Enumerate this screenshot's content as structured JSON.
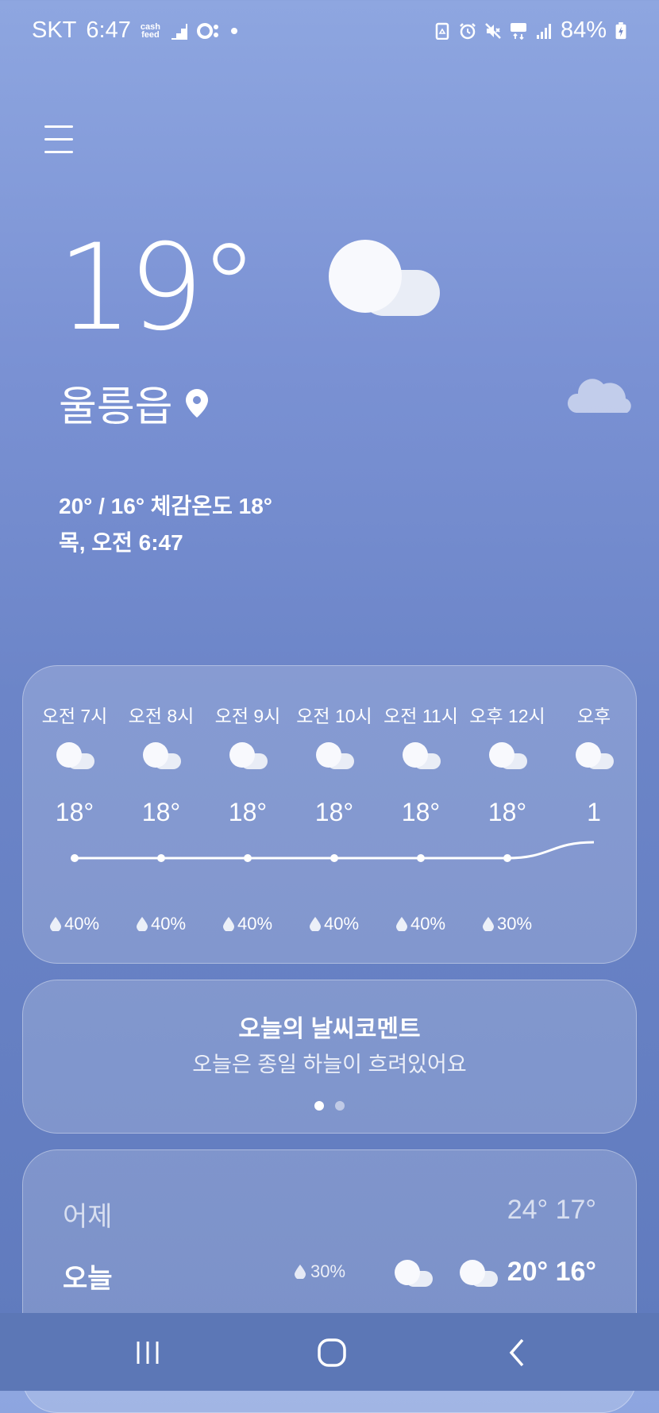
{
  "status_bar": {
    "carrier": "SKT",
    "time": "6:47",
    "cashfeed_top": "cash",
    "cashfeed_bottom": "feed",
    "battery": "84%"
  },
  "current": {
    "temperature": "19°",
    "location": "울릉읍",
    "minmax_feels": "20° / 16° 체감온도 18°",
    "datetime": "목, 오전 6:47",
    "icon": "cloudy-icon"
  },
  "hourly": [
    {
      "time": "오전 7시",
      "temp": "18°",
      "rain": "40%",
      "temp_value": 18
    },
    {
      "time": "오전 8시",
      "temp": "18°",
      "rain": "40%",
      "temp_value": 18
    },
    {
      "time": "오전 9시",
      "temp": "18°",
      "rain": "40%",
      "temp_value": 18
    },
    {
      "time": "오전 10시",
      "temp": "18°",
      "rain": "40%",
      "temp_value": 18
    },
    {
      "time": "오전 11시",
      "temp": "18°",
      "rain": "40%",
      "temp_value": 18
    },
    {
      "time": "오후 12시",
      "temp": "18°",
      "rain": "30%",
      "temp_value": 18
    },
    {
      "time": "오후",
      "temp": "1",
      "rain": "",
      "temp_value": 19
    }
  ],
  "comment": {
    "title": "오늘의 날씨코멘트",
    "body": "오늘은 종일 하늘이 흐려있어요",
    "page": 1,
    "pages": 2
  },
  "daily": {
    "yesterday": {
      "label": "어제",
      "temps": "24° 17°"
    },
    "today": {
      "label": "오늘",
      "rain": "30%",
      "temps": "20° 16°"
    }
  },
  "colors": {
    "accent": "#ffffff",
    "background_top": "#8ea6e0",
    "background_bottom": "#5f7abd"
  }
}
